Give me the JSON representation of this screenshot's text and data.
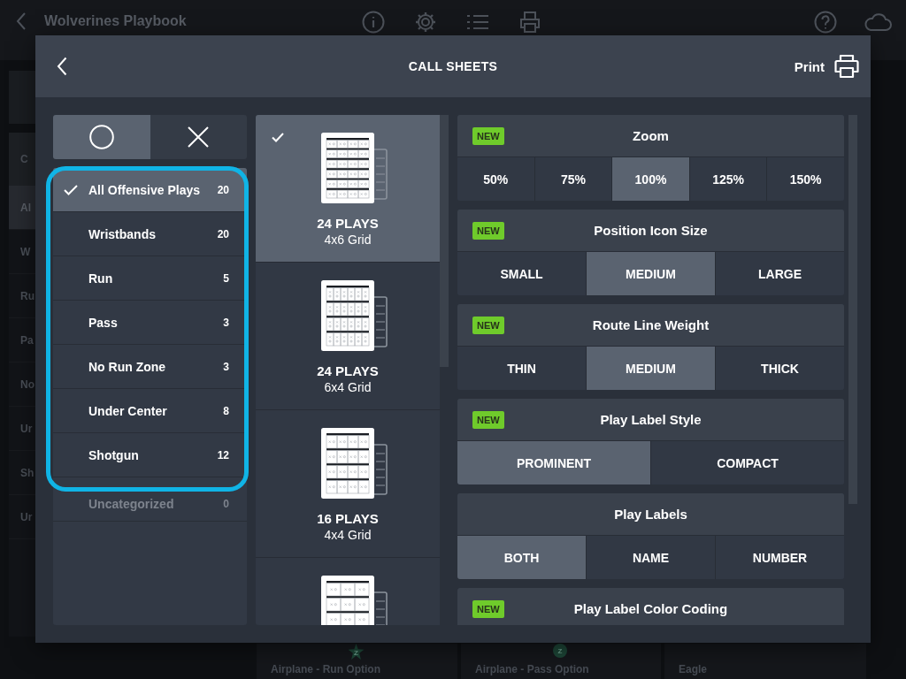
{
  "background": {
    "title": "Wolverines Playbook",
    "sidebar_heading": "C",
    "sidebar_items": [
      {
        "label": "Al",
        "selected": true
      },
      {
        "label": "W",
        "selected": false
      },
      {
        "label": "Ru",
        "selected": false
      },
      {
        "label": "Pa",
        "selected": false
      },
      {
        "label": "No",
        "selected": false
      },
      {
        "label": "Ur",
        "selected": false
      },
      {
        "label": "Sh",
        "selected": false
      },
      {
        "label": "Ur",
        "selected": false
      }
    ],
    "cards": [
      {
        "title": "Airplane - Run Option",
        "badge": "Z",
        "kind": "star"
      },
      {
        "title": "Airplane - Pass Option",
        "badge": "Z",
        "kind": "circle"
      },
      {
        "title": "Eagle"
      }
    ]
  },
  "dialog": {
    "title": "CALL SHEETS",
    "print_label": "Print"
  },
  "play_side_toggle": [
    {
      "kind": "circle",
      "selected": true
    },
    {
      "kind": "cross",
      "selected": false
    }
  ],
  "categories": [
    {
      "label": "All Offensive Plays",
      "count": "20",
      "selected": true,
      "faded": false
    },
    {
      "label": "Wristbands",
      "count": "20",
      "selected": false,
      "faded": false
    },
    {
      "label": "Run",
      "count": "5",
      "selected": false,
      "faded": false
    },
    {
      "label": "Pass",
      "count": "3",
      "selected": false,
      "faded": false
    },
    {
      "label": "No Run Zone",
      "count": "3",
      "selected": false,
      "faded": false
    },
    {
      "label": "Under Center",
      "count": "8",
      "selected": false,
      "faded": false
    },
    {
      "label": "Shotgun",
      "count": "12",
      "selected": false,
      "faded": false
    },
    {
      "label": "Uncategorized",
      "count": "0",
      "selected": false,
      "faded": true
    }
  ],
  "layouts": [
    {
      "kind": "grid4x6",
      "plays": "24 PLAYS",
      "grid": "4x6 Grid",
      "selected": true
    },
    {
      "kind": "grid6x4",
      "plays": "24 PLAYS",
      "grid": "6x4 Grid",
      "selected": false
    },
    {
      "kind": "grid4x4",
      "plays": "16 PLAYS",
      "grid": "4x4 Grid",
      "selected": false
    },
    {
      "kind": "grid3x4",
      "selected": false
    }
  ],
  "settings": [
    {
      "title": "Zoom",
      "new": true,
      "badge": "NEW",
      "options": [
        {
          "label": "50%",
          "selected": false
        },
        {
          "label": "75%",
          "selected": false
        },
        {
          "label": "100%",
          "selected": true
        },
        {
          "label": "125%",
          "selected": false
        },
        {
          "label": "150%",
          "selected": false
        }
      ]
    },
    {
      "title": "Position Icon Size",
      "new": true,
      "badge": "NEW",
      "options": [
        {
          "label": "SMALL",
          "selected": false
        },
        {
          "label": "MEDIUM",
          "selected": true
        },
        {
          "label": "LARGE",
          "selected": false
        }
      ]
    },
    {
      "title": "Route Line Weight",
      "new": true,
      "badge": "NEW",
      "options": [
        {
          "label": "THIN",
          "selected": false
        },
        {
          "label": "MEDIUM",
          "selected": true
        },
        {
          "label": "THICK",
          "selected": false
        }
      ]
    },
    {
      "title": "Play Label Style",
      "new": true,
      "badge": "NEW",
      "options": [
        {
          "label": "PROMINENT",
          "selected": true
        },
        {
          "label": "COMPACT",
          "selected": false
        }
      ]
    },
    {
      "title": "Play Labels",
      "new": false,
      "options": [
        {
          "label": "BOTH",
          "selected": true
        },
        {
          "label": "NAME",
          "selected": false
        },
        {
          "label": "NUMBER",
          "selected": false
        }
      ]
    },
    {
      "title": "Play Label Color Coding",
      "new": true,
      "badge": "NEW"
    }
  ]
}
